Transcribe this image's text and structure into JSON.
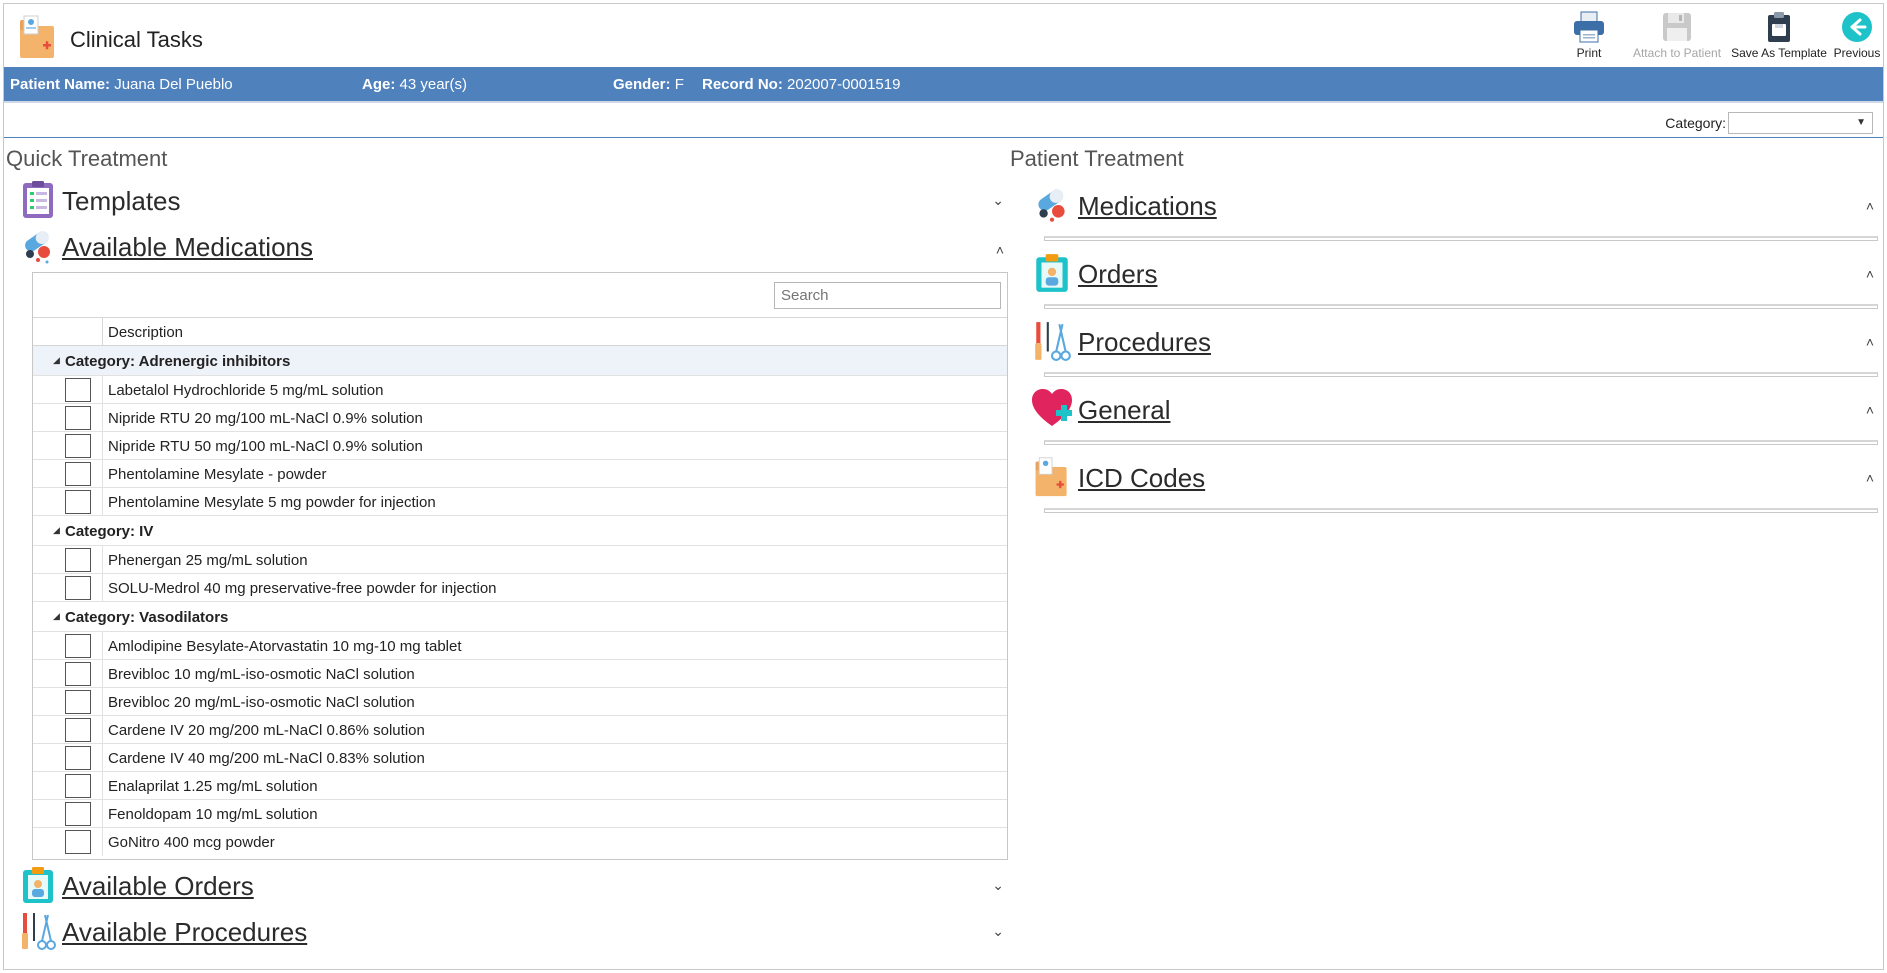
{
  "app": {
    "title": "Clinical Tasks"
  },
  "toolbar": {
    "print": "Print",
    "attach": "Attach to Patient",
    "save_template": "Save As Template",
    "previous": "Previous"
  },
  "patient": {
    "name_label": "Patient Name:",
    "name": "Juana Del Pueblo",
    "age_label": "Age:",
    "age": "43 year(s)",
    "gender_label": "Gender:",
    "gender": "F",
    "record_label": "Record No:",
    "record": "202007-0001519"
  },
  "filter": {
    "category_label": "Category:",
    "category_value": ""
  },
  "quick": {
    "header": "Quick Treatment",
    "templates": "Templates",
    "available_medications": "Available Medications",
    "available_orders": "Available Orders",
    "available_procedures": "Available Procedures"
  },
  "grid": {
    "search_placeholder": "Search",
    "col_description": "Description",
    "groups": [
      {
        "title": "Category: Adrenergic inhibitors",
        "items": [
          "Labetalol Hydrochloride 5 mg/mL solution",
          "Nipride RTU 20 mg/100 mL-NaCl 0.9% solution",
          "Nipride RTU 50 mg/100 mL-NaCl 0.9% solution",
          "Phentolamine Mesylate - powder",
          "Phentolamine Mesylate 5 mg powder for injection"
        ]
      },
      {
        "title": "Category: IV",
        "items": [
          "Phenergan 25 mg/mL solution",
          "SOLU-Medrol 40 mg preservative-free powder for injection"
        ]
      },
      {
        "title": "Category: Vasodilators",
        "items": [
          "Amlodipine Besylate-Atorvastatin 10 mg-10 mg tablet",
          "Brevibloc 10 mg/mL-iso-osmotic NaCl solution",
          "Brevibloc 20 mg/mL-iso-osmotic NaCl solution",
          "Cardene IV 20 mg/200 mL-NaCl 0.86% solution",
          "Cardene IV 40 mg/200 mL-NaCl 0.83% solution",
          "Enalaprilat 1.25 mg/mL solution",
          "Fenoldopam 10 mg/mL solution",
          "GoNitro 400 mcg powder"
        ]
      }
    ]
  },
  "patient_treatment": {
    "header": "Patient Treatment",
    "medications": "Medications",
    "orders": "Orders",
    "procedures": "Procedures",
    "general": "General",
    "icd_codes": "ICD Codes"
  },
  "icons": {
    "app": "medical-folder-icon",
    "print": "printer-icon",
    "attach": "floppy-disk-icon",
    "save_template": "clipboard-save-icon",
    "previous": "back-arrow-icon"
  },
  "colors": {
    "patient_bar": "#4f81bd",
    "previous_button": "#1ec2c9"
  }
}
